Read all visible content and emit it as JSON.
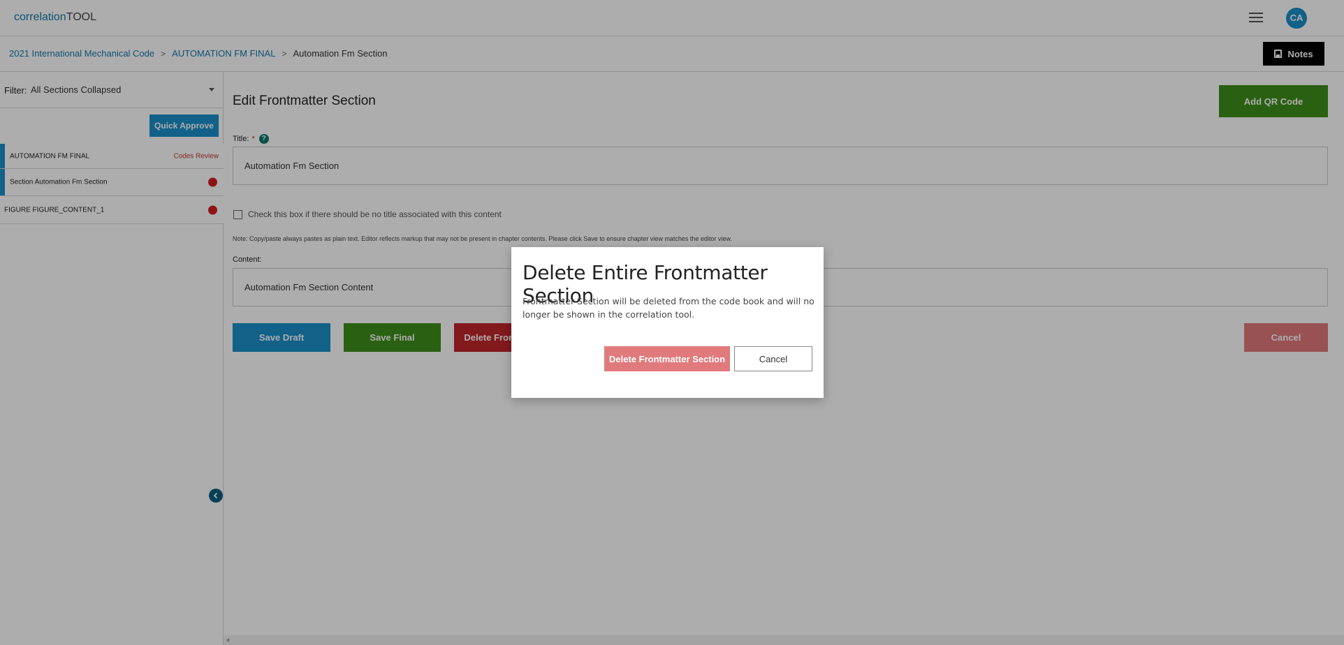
{
  "app": {
    "logo_part1": "correlation",
    "logo_part2": "TOOL"
  },
  "header": {
    "avatar_initials": "CA",
    "menu_icon": "hamburger-icon"
  },
  "breadcrumb": {
    "items": [
      "2021 International Mechanical Code",
      "AUTOMATION FM FINAL"
    ],
    "current": "Automation Fm Section",
    "separator": ">"
  },
  "notes_button": {
    "label": "Notes",
    "icon": "save-icon"
  },
  "sidebar": {
    "filter_label": "Filter:",
    "filter_value": "All Sections Collapsed",
    "quick_approve_label": "Quick Approve",
    "items": [
      {
        "label": "AUTOMATION FM FINAL",
        "status": "Codes Review"
      },
      {
        "label": "Section Automation Fm Section"
      },
      {
        "label": "FIGURE FIGURE_CONTENT_1"
      }
    ],
    "collapse_icon": "chevron-left-icon"
  },
  "main": {
    "title": "Edit Frontmatter Section",
    "add_qr_label": "Add QR Code",
    "title_field_label": "Title:",
    "required_marker": "*",
    "help_icon_glyph": "?",
    "title_value": "Automation Fm Section",
    "no_title_checkbox_label": "Check this box if there should be no title associated with this content",
    "note": "Note: Copy/paste always pastes as plain text. Editor reflects markup that may not be present in chapter contents. Please click Save to ensure chapter view matches the editor view.",
    "content_label": "Content:",
    "content_value": "Automation Fm Section Content",
    "buttons": {
      "save_draft": "Save Draft",
      "save_final": "Save Final",
      "delete": "Delete Frontmatter Section",
      "cancel": "Cancel"
    }
  },
  "modal": {
    "title": "Delete Entire Frontmatter Section",
    "body": "Frontmatter Section will be deleted from the code book and will no longer be shown in the correlation tool.",
    "confirm_label": "Delete Frontmatter Section",
    "cancel_label": "Cancel"
  },
  "colors": {
    "brand_blue": "#1a8fc9",
    "save_final_green": "#3e8e1a",
    "delete_red": "#c0262c",
    "cancel_red": "#e07a7c",
    "status_dot": "#d32020"
  }
}
